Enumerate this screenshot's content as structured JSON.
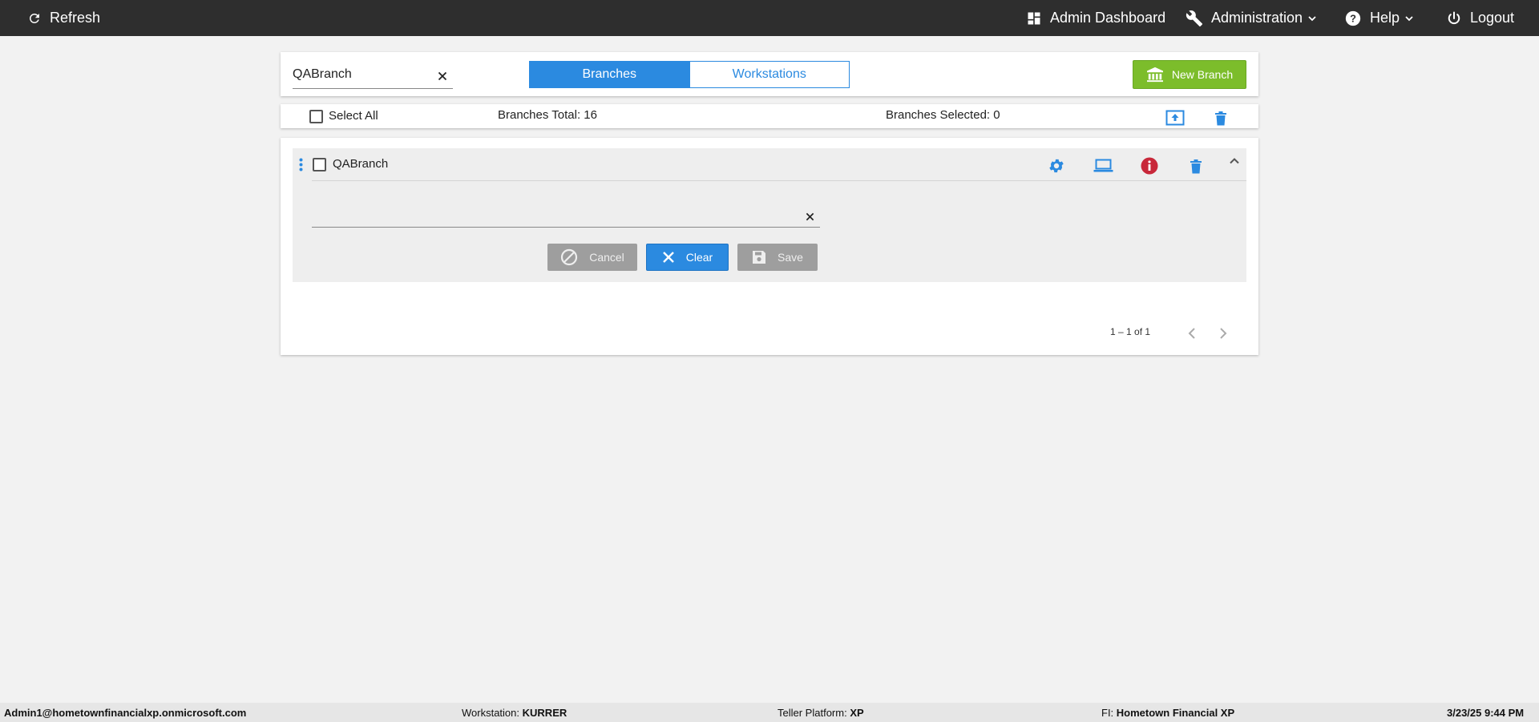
{
  "topbar": {
    "refresh": "Refresh",
    "admin_dashboard": "Admin Dashboard",
    "administration": "Administration",
    "help": "Help",
    "logout": "Logout"
  },
  "search": {
    "value": "QABranch",
    "placeholder": ""
  },
  "tabs": {
    "branches": "Branches",
    "workstations": "Workstations",
    "active": "Branches"
  },
  "new_branch_label": "New Branch",
  "toolbar": {
    "select_all": "Select All",
    "branches_total": "Branches Total: 16",
    "branches_selected": "Branches Selected: 0"
  },
  "branch": {
    "name": "QABranch",
    "edit_value": "",
    "cancel": "Cancel",
    "clear": "Clear",
    "save": "Save"
  },
  "pagination": {
    "range": "1 – 1 of 1"
  },
  "footer": {
    "user": "Admin1@hometownfinancialxp.onmicrosoft.com",
    "workstation_label": "Workstation:",
    "workstation": "KURRER",
    "platform_label": "Teller Platform:",
    "platform": "XP",
    "fi_label": "FI:",
    "fi": "Hometown Financial XP",
    "datetime": "3/23/25 9:44 PM"
  },
  "colors": {
    "accent": "#2b8ae0",
    "success": "#7cbd2b",
    "danger": "#c8283a",
    "topbar": "#2e2e2e"
  },
  "icons": [
    "refresh-icon",
    "dashboard-icon",
    "wrench-icon",
    "help-icon",
    "power-icon",
    "bank-icon",
    "upload-icon",
    "trash-icon",
    "gear-icon",
    "laptop-icon",
    "info-icon",
    "chevron-up-icon",
    "more-vert-icon",
    "cancel-icon",
    "close-icon",
    "floppy-icon",
    "chevron-left-icon",
    "chevron-right-icon"
  ]
}
